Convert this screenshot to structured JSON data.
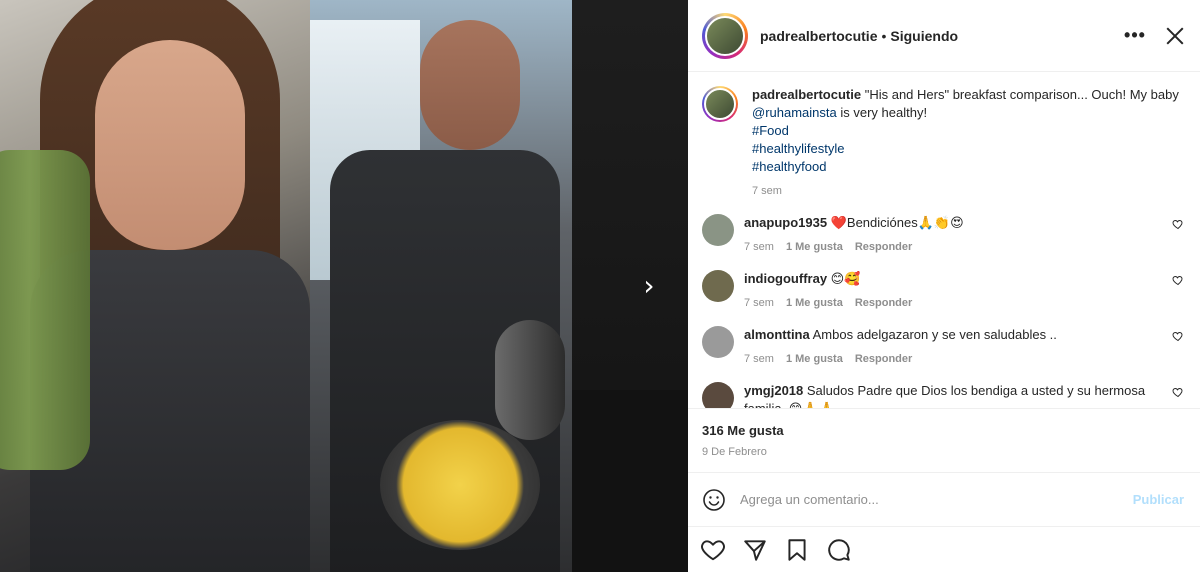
{
  "post": {
    "username": "padrealbertocutie",
    "separator": "•",
    "follow_status": "Siguiendo",
    "more_label": "•••",
    "caption_text": "\"His and Hers\" breakfast comparison... Ouch! My baby ",
    "caption_mention": "@ruhamainsta",
    "caption_tail": " is very healthy!",
    "hashtags": [
      "#Food",
      "#healthylifestyle",
      "#healthyfood"
    ],
    "caption_time": "7 sem"
  },
  "comments": [
    {
      "user": "anapupo1935",
      "text": "❤️Bendiciónes🙏👏😍",
      "time": "7 sem",
      "likes": "1 Me gusta",
      "reply": "Responder",
      "avatar_color": "#8a9485"
    },
    {
      "user": "indiogouffray",
      "text": "😊🥰",
      "time": "7 sem",
      "likes": "1 Me gusta",
      "reply": "Responder",
      "avatar_color": "#6f6a4e"
    },
    {
      "user": "almonttina",
      "text": "Ambos adelgazaron y se ven saludables ..",
      "time": "7 sem",
      "likes": "1 Me gusta",
      "reply": "Responder",
      "avatar_color": "#9a9a9a"
    },
    {
      "user": "ymgj2018",
      "text": "Saludos Padre que Dios los bendiga a usted y su hermosa familia. 😊🙏🙏",
      "time": "",
      "likes": "",
      "reply": "",
      "avatar_color": "#5a4a3e"
    }
  ],
  "stats": {
    "likes": "316 Me gusta",
    "date": "9 De Febrero"
  },
  "composer": {
    "placeholder": "Agrega un comentario...",
    "publish": "Publicar"
  },
  "icons": {
    "close": "close-icon",
    "next": "chevron-right-icon",
    "like": "heart-icon",
    "comment": "comment-bubble-icon",
    "share": "paper-plane-icon",
    "save": "bookmark-icon",
    "emoji": "smiley-icon"
  },
  "colors": {
    "link": "#00376b",
    "muted": "#8e8e8e",
    "publish_disabled": "#b2dffc"
  }
}
